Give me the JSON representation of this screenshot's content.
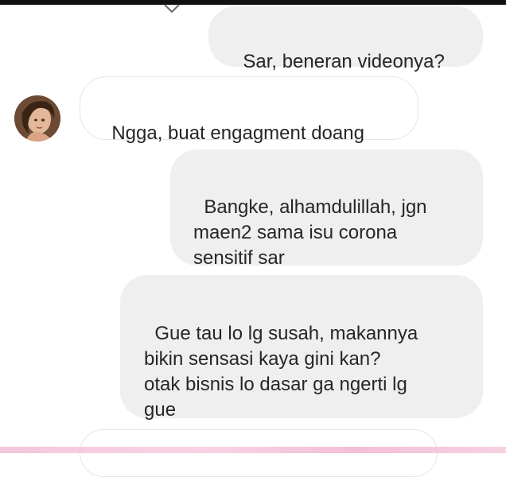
{
  "chat": {
    "messages": [
      {
        "sender": "self",
        "text": "Sar, beneran videonya?"
      },
      {
        "sender": "other",
        "text": "Ngga, buat engagment doang"
      },
      {
        "sender": "self",
        "text": "Bangke, alhamdulillah, jgn\nmaen2 sama isu corona\nsensitif sar"
      },
      {
        "sender": "self",
        "text": "Gue tau lo lg susah, makannya\nbikin sensasi kaya gini kan?\notak bisnis lo dasar ga ngerti lg\ngue"
      }
    ]
  },
  "colors": {
    "sent_bubble": "#efefef",
    "received_bubble": "#ffffff",
    "received_border": "#e6e6e6",
    "text": "#262626",
    "bottom_bar": "#f5c6dc"
  },
  "icons": {
    "avatar": "contact-avatar-photo",
    "tail": "bubble-tail-mark"
  }
}
